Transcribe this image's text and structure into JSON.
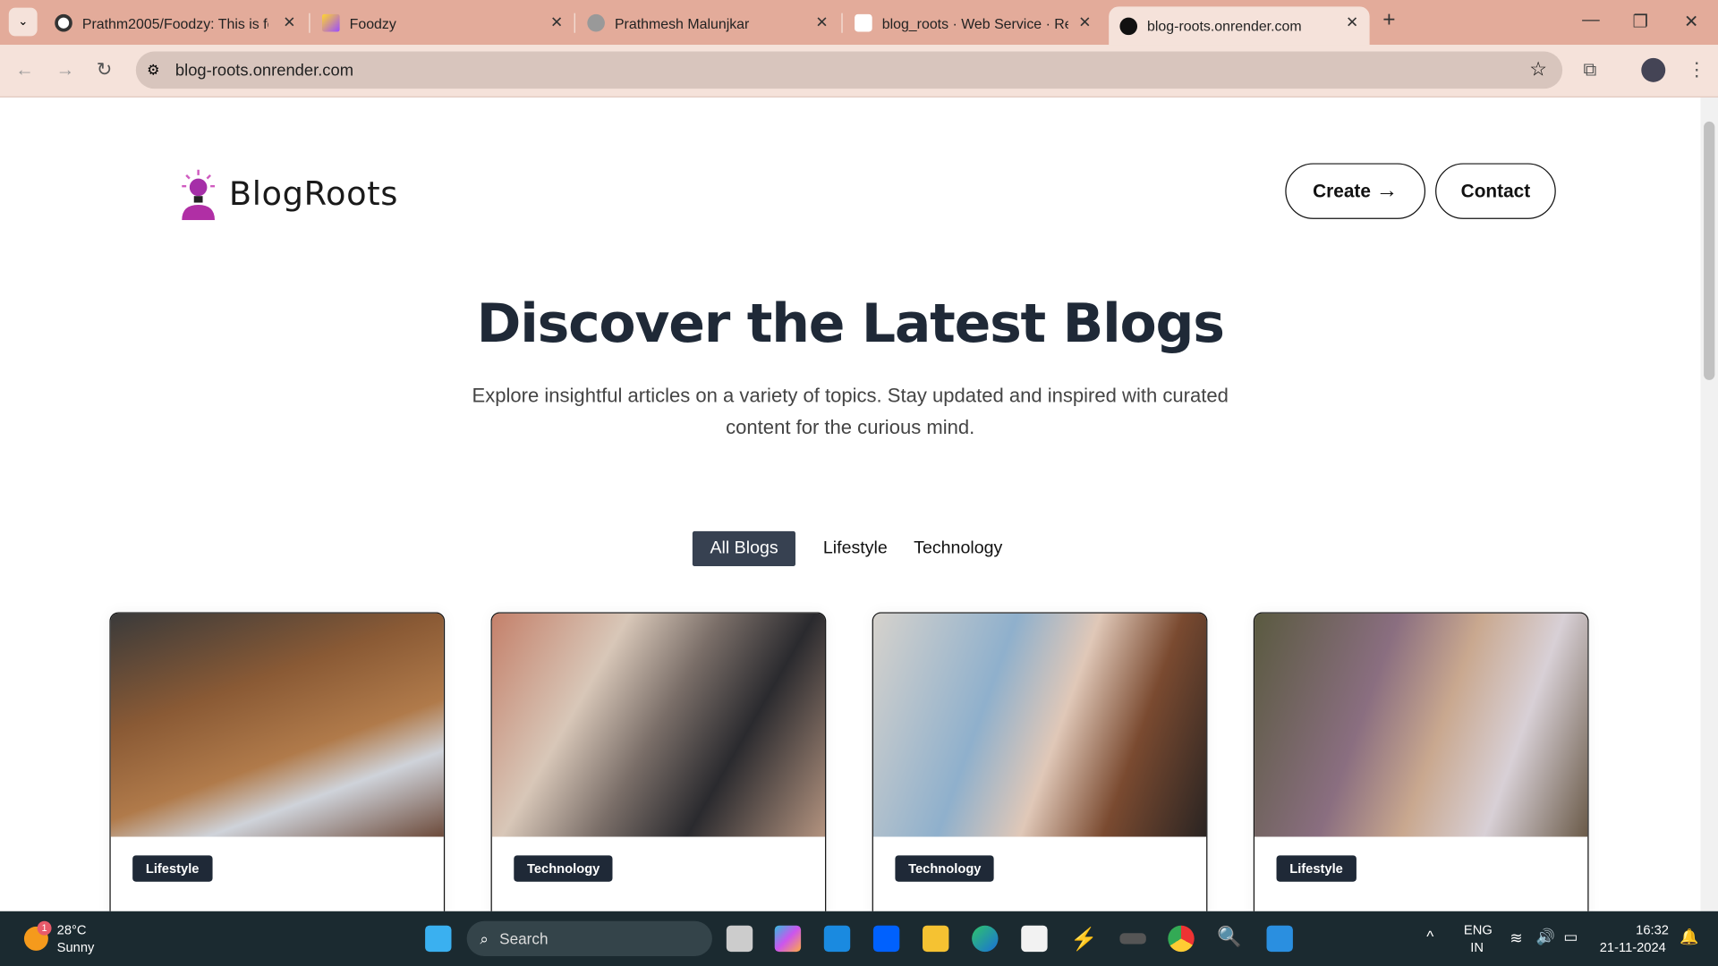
{
  "browser": {
    "tabs": [
      {
        "title": "Prathm2005/Foodzy: This is foo",
        "icon": "github-icon"
      },
      {
        "title": "Foodzy",
        "icon": "vite-icon"
      },
      {
        "title": "Prathmesh Malunjkar",
        "icon": "globe-icon"
      },
      {
        "title": "blog_roots · Web Service · Ren",
        "icon": "render-icon"
      },
      {
        "title": "blog-roots.onrender.com",
        "icon": "site-icon",
        "active": true
      }
    ],
    "url": "blog-roots.onrender.com"
  },
  "site": {
    "brand": "BlogRoots",
    "nav": {
      "create": "Create",
      "contact": "Contact"
    },
    "hero": {
      "title": "Discover the Latest Blogs",
      "subtitle": "Explore insightful articles on a variety of topics. Stay updated and inspired with curated content for the curious mind."
    },
    "filters": [
      {
        "label": "All Blogs",
        "active": true
      },
      {
        "label": "Lifestyle"
      },
      {
        "label": "Technology"
      }
    ],
    "cards": [
      {
        "category": "Lifestyle"
      },
      {
        "category": "Technology"
      },
      {
        "category": "Technology"
      },
      {
        "category": "Lifestyle"
      }
    ]
  },
  "taskbar": {
    "weather": {
      "temp": "28°C",
      "condition": "Sunny",
      "badge": "1"
    },
    "search": "Search",
    "lang": "ENG",
    "region": "IN",
    "time": "16:32",
    "date": "21-11-2024"
  }
}
